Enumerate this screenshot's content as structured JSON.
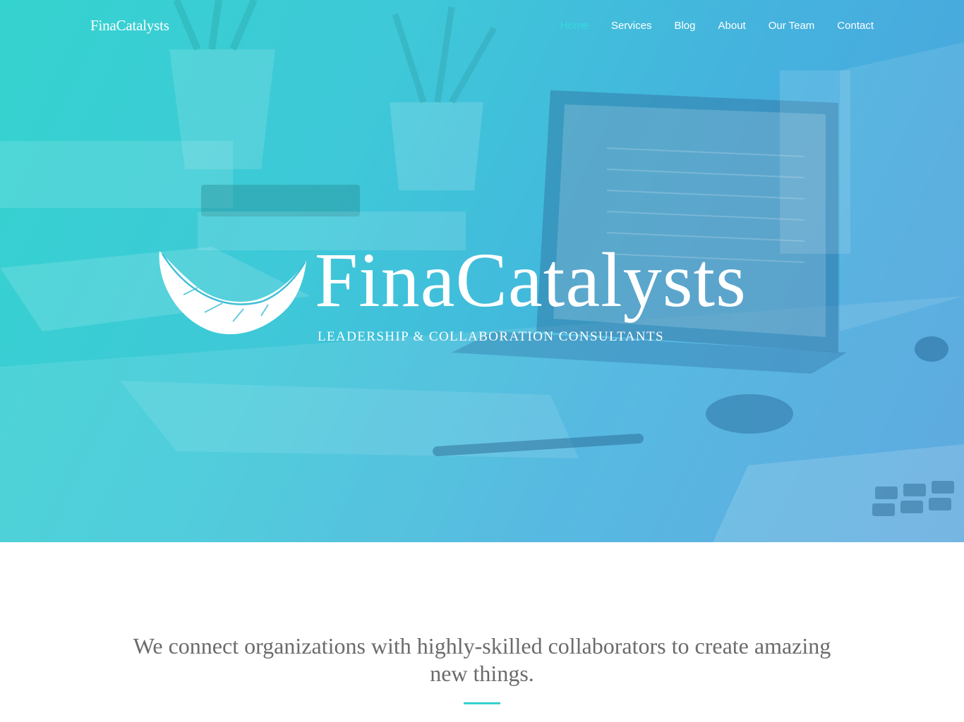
{
  "header": {
    "brand": "FinaCatalysts",
    "nav": [
      {
        "label": "Home",
        "active": true
      },
      {
        "label": "Services",
        "active": false
      },
      {
        "label": "Blog",
        "active": false
      },
      {
        "label": "About",
        "active": false
      },
      {
        "label": "Our Team",
        "active": false
      },
      {
        "label": "Contact",
        "active": false
      }
    ]
  },
  "hero": {
    "logo_text": "FinaCatalysts",
    "tagline": "LEADERSHIP & COLLABORATION CONSULTANTS"
  },
  "intro": {
    "text": "We connect organizations with highly-skilled collaborators to create amazing new things."
  },
  "colors": {
    "accent": "#36d9dd",
    "hero_start": "#35d3cf",
    "hero_end": "#4da0dc",
    "body_text": "#6b6b6b"
  }
}
